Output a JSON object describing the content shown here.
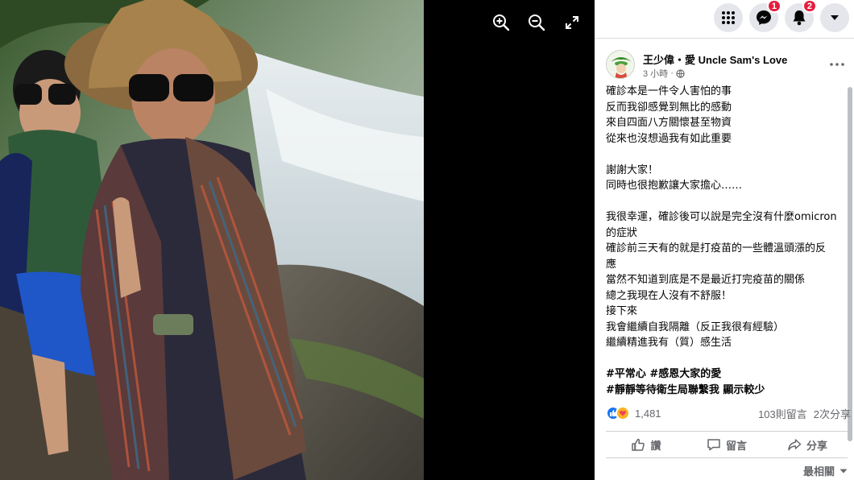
{
  "viewer": {
    "zoom_in_icon": "zoom-in-icon",
    "zoom_out_icon": "zoom-out-icon",
    "fullscreen_icon": "expand-icon"
  },
  "topbar": {
    "menu_icon": "grid-menu-icon",
    "messenger_icon": "messenger-icon",
    "messenger_badge": "1",
    "notifications_icon": "bell-icon",
    "notifications_badge": "2",
    "account_icon": "caret-down-icon"
  },
  "post": {
    "author": "王少偉・愛 Uncle Sam's Love",
    "time": "3 小時",
    "separator": "·",
    "audience_icon": "globe-icon",
    "paragraphs": [
      [
        "確診本是一件令人害怕的事",
        "反而我卻感覺到無比的感動",
        "來自四面八方關懷甚至物資",
        "從來也沒想過我有如此重要"
      ],
      [
        "謝謝大家！",
        "同時也很抱歉讓大家擔心……"
      ],
      [
        "我很幸運，確診後可以說是完全沒有什麼omicron",
        "的症狀",
        "確診前三天有的就是打疫苗的一些體溫頭漲的反",
        "應",
        "當然不知道到底是不是最近打完疫苗的關係",
        "總之我現在人沒有不舒服！",
        "接下來",
        "我會繼續自我隔離（反正我很有經驗）",
        "繼續精進我有（質）感生活"
      ],
      [
        "#平常心 #感恩大家的愛",
        "#靜靜等待衛生局聯繫我 顯示較少"
      ]
    ],
    "reaction_count": "1,481",
    "comments": "103則留言",
    "shares": "2次分享",
    "like_label": "讚",
    "comment_label": "留言",
    "share_label": "分享",
    "sort_label": "最相關",
    "colors": {
      "like": "#1877f2",
      "love": "#f33e58",
      "care": "#f7b125"
    }
  }
}
